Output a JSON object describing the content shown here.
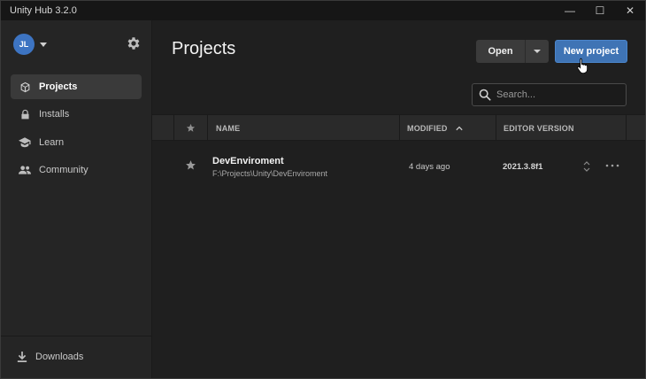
{
  "window": {
    "title": "Unity Hub 3.2.0",
    "controls": {
      "minimize": "—",
      "maximize": "☐",
      "close": "✕"
    }
  },
  "sidebar": {
    "avatar_initials": "JL",
    "items": [
      {
        "label": "Projects",
        "icon": "cube-icon",
        "active": true
      },
      {
        "label": "Installs",
        "icon": "lock-icon",
        "active": false
      },
      {
        "label": "Learn",
        "icon": "graduation-cap-icon",
        "active": false
      },
      {
        "label": "Community",
        "icon": "people-icon",
        "active": false
      }
    ],
    "downloads_label": "Downloads"
  },
  "main": {
    "title": "Projects",
    "open_label": "Open",
    "new_project_label": "New project",
    "search_placeholder": "Search..."
  },
  "table": {
    "columns": {
      "name": "NAME",
      "modified": "MODIFIED",
      "editor_version": "EDITOR VERSION"
    },
    "sort_column": "modified",
    "sort_direction": "ascending",
    "rows": [
      {
        "name": "DevEnviroment",
        "path": "F:\\Projects\\Unity\\DevEnviroment",
        "modified": "4 days ago",
        "editor_version": "2021.3.8f1"
      }
    ]
  },
  "colors": {
    "accent": "#3f74b5",
    "avatar": "#3d74c2",
    "background": "#1f1f1f",
    "sidebar": "#252525"
  }
}
